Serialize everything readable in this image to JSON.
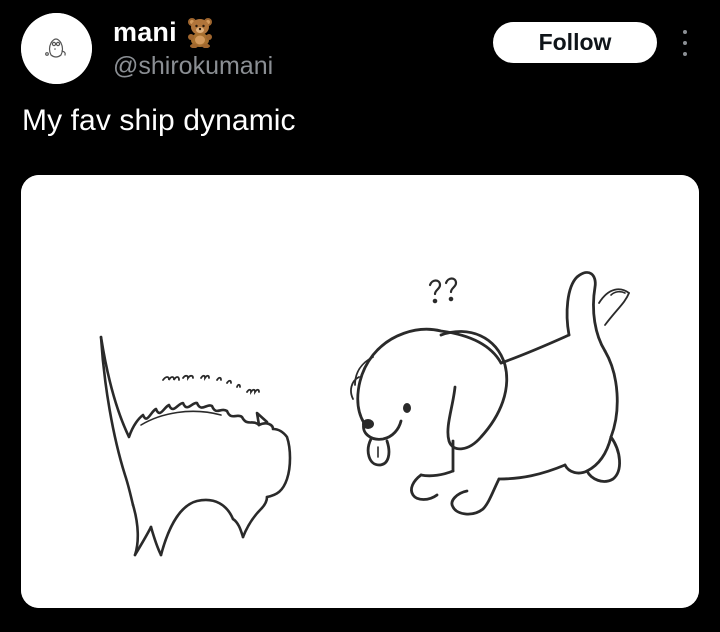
{
  "author": {
    "display_name": "mani",
    "handle": "@shirokumani",
    "badge_icon": "teddy-bear-icon"
  },
  "actions": {
    "follow_label": "Follow",
    "more_icon": "more-vertical-icon"
  },
  "post": {
    "text": "My fav ship dynamic",
    "media": {
      "question_marks": "??",
      "hiss_sound": "mrrreeow",
      "background_color": "#ffffff"
    }
  },
  "theme": {
    "background": "#000000",
    "text_primary": "#ffffff",
    "text_secondary": "#8b8f94",
    "button_bg": "#ffffff",
    "button_text": "#0f1419"
  }
}
